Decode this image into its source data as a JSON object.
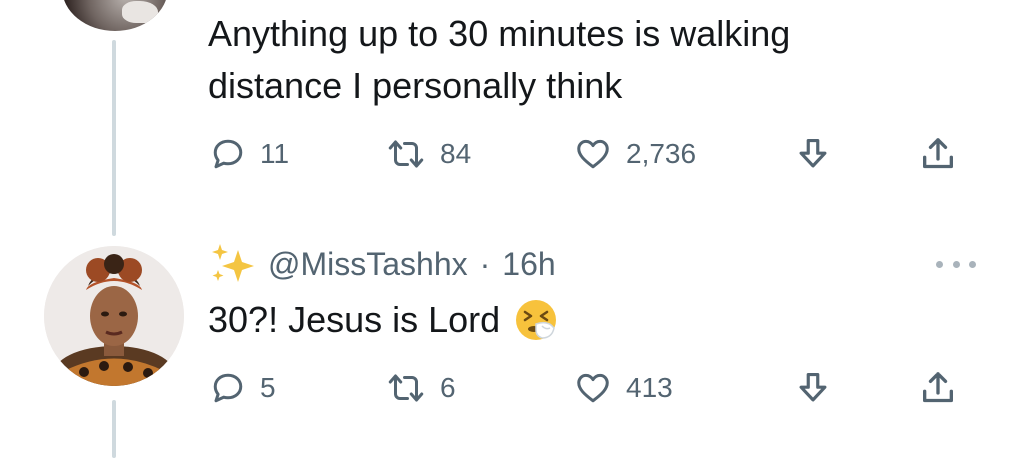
{
  "tweet_1": {
    "text_line_1": "Anything up to 30 minutes is walking",
    "text_line_2": "distance I personally think",
    "replies": "11",
    "retweets": "84",
    "likes": "2,736"
  },
  "tweet_2": {
    "handle": "@MissTashhx",
    "separator": "·",
    "time": "16h",
    "text": "30?! Jesus is Lord",
    "emoji": "sneezing-face-emoji",
    "replies": "5",
    "retweets": "6",
    "likes": "413"
  },
  "colors": {
    "icon_gray": "#536471",
    "thread_line": "#cfd9de",
    "sparkle": "#f4c542"
  }
}
